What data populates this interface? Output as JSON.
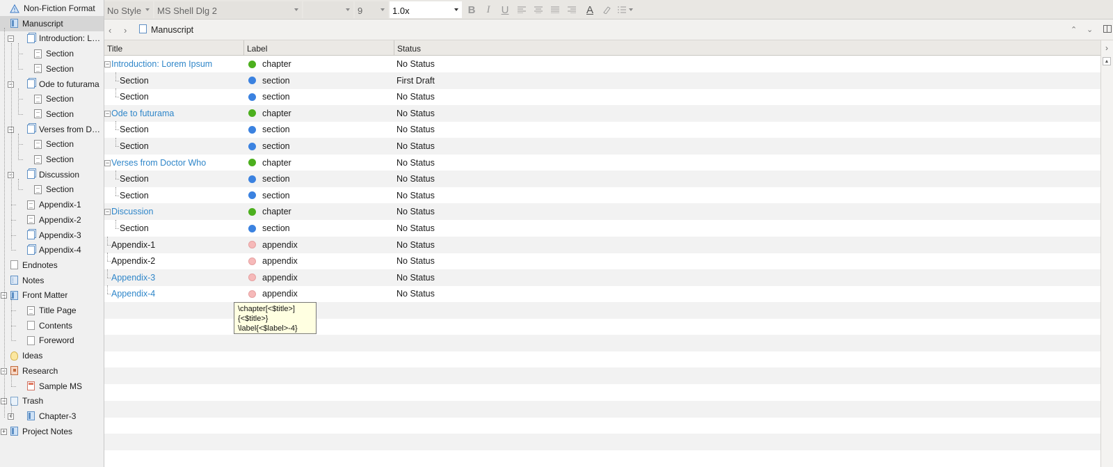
{
  "binder": {
    "items": [
      {
        "label": "Non-Fiction Format",
        "icon": "warning-icon",
        "level": 0
      },
      {
        "label": "Manuscript",
        "icon": "folder-icon",
        "level": 0,
        "selected": true
      },
      {
        "label": "Introduction: Lorem Ipsum",
        "icon": "stack-icon",
        "level": 1,
        "expanded": true
      },
      {
        "label": "Section",
        "icon": "document-icon",
        "level": 2
      },
      {
        "label": "Section",
        "icon": "document-icon",
        "level": 2
      },
      {
        "label": "Ode to futurama",
        "icon": "stack-icon",
        "level": 1,
        "expanded": true
      },
      {
        "label": "Section",
        "icon": "document-icon",
        "level": 2
      },
      {
        "label": "Section",
        "icon": "document-icon",
        "level": 2
      },
      {
        "label": "Verses from Doctor Who",
        "icon": "stack-icon",
        "level": 1,
        "expanded": true
      },
      {
        "label": "Section",
        "icon": "document-icon",
        "level": 2
      },
      {
        "label": "Section",
        "icon": "document-icon",
        "level": 2
      },
      {
        "label": "Discussion",
        "icon": "stack-icon",
        "level": 1,
        "expanded": true
      },
      {
        "label": "Section",
        "icon": "document-icon",
        "level": 2
      },
      {
        "label": "Appendix-1",
        "icon": "document-icon",
        "level": 1
      },
      {
        "label": "Appendix-2",
        "icon": "document-icon",
        "level": 1
      },
      {
        "label": "Appendix-3",
        "icon": "stack-icon",
        "level": 1
      },
      {
        "label": "Appendix-4",
        "icon": "stack-icon",
        "level": 1
      },
      {
        "label": "Endnotes",
        "icon": "blank-document-icon",
        "level": 0
      },
      {
        "label": "Notes",
        "icon": "notes-icon",
        "level": 0
      },
      {
        "label": "Front Matter",
        "icon": "folder-icon",
        "level": 0,
        "expanded": true
      },
      {
        "label": "Title Page",
        "icon": "document-icon",
        "level": 1
      },
      {
        "label": "Contents",
        "icon": "blank-document-icon",
        "level": 1
      },
      {
        "label": "Foreword",
        "icon": "blank-document-icon",
        "level": 1
      },
      {
        "label": "Ideas",
        "icon": "lightbulb-icon",
        "level": 0
      },
      {
        "label": "Research",
        "icon": "research-folder-icon",
        "level": 0,
        "expanded": true
      },
      {
        "label": "Sample MS",
        "icon": "manuscript-icon",
        "level": 1
      },
      {
        "label": "Trash",
        "icon": "trash-icon",
        "level": 0,
        "expanded": true
      },
      {
        "label": "Chapter-3",
        "icon": "folder-icon",
        "level": 1,
        "collapsed": true
      },
      {
        "label": "Project Notes",
        "icon": "folder-icon",
        "level": 0,
        "collapsed": true
      }
    ]
  },
  "format_bar": {
    "style": "No Style",
    "font": "MS Shell Dlg 2",
    "size": "9",
    "line_spacing": "1.0x",
    "buttons": [
      "bold-icon",
      "italic-icon",
      "underline-icon",
      "align-left-icon",
      "align-center-icon",
      "align-justify-icon",
      "align-right-icon",
      "text-color-icon",
      "highlight-icon",
      "list-icon"
    ],
    "glyphs": {
      "bold": "B",
      "italic": "I",
      "underline": "U",
      "text_color": "A"
    }
  },
  "header": {
    "title": "Manuscript"
  },
  "outliner": {
    "columns": [
      "Title",
      "Label",
      "Status"
    ],
    "rows": [
      {
        "title": "Introduction: Lorem Ipsum",
        "label": "chapter",
        "status": "No Status",
        "depth": 0,
        "expanded": true,
        "link": true,
        "label_color": "#4caf1e"
      },
      {
        "title": "Section",
        "label": "section",
        "status": "First Draft",
        "depth": 1,
        "label_color": "#3b82e0"
      },
      {
        "title": "Section",
        "label": "section",
        "status": "No Status",
        "depth": 1,
        "label_color": "#3b82e0"
      },
      {
        "title": "Ode to futurama",
        "label": "chapter",
        "status": "No Status",
        "depth": 0,
        "expanded": true,
        "link": true,
        "label_color": "#4caf1e"
      },
      {
        "title": "Section",
        "label": "section",
        "status": "No Status",
        "depth": 1,
        "label_color": "#3b82e0"
      },
      {
        "title": "Section",
        "label": "section",
        "status": "No Status",
        "depth": 1,
        "label_color": "#3b82e0"
      },
      {
        "title": "Verses from Doctor Who",
        "label": "chapter",
        "status": "No Status",
        "depth": 0,
        "expanded": true,
        "link": true,
        "label_color": "#4caf1e"
      },
      {
        "title": "Section",
        "label": "section",
        "status": "No Status",
        "depth": 1,
        "label_color": "#3b82e0"
      },
      {
        "title": "Section",
        "label": "section",
        "status": "No Status",
        "depth": 1,
        "label_color": "#3b82e0"
      },
      {
        "title": "Discussion",
        "label": "chapter",
        "status": "No Status",
        "depth": 0,
        "expanded": true,
        "link": true,
        "label_color": "#4caf1e"
      },
      {
        "title": "Section",
        "label": "section",
        "status": "No Status",
        "depth": 1,
        "label_color": "#3b82e0"
      },
      {
        "title": "Appendix-1",
        "label": "appendix",
        "status": "No Status",
        "depth": 0,
        "label_color": "#f6b9b9"
      },
      {
        "title": "Appendix-2",
        "label": "appendix",
        "status": "No Status",
        "depth": 0,
        "label_color": "#f6b9b9"
      },
      {
        "title": "Appendix-3",
        "label": "appendix",
        "status": "No Status",
        "depth": 0,
        "link": true,
        "label_color": "#f6b9b9"
      },
      {
        "title": "Appendix-4",
        "label": "appendix",
        "status": "No Status",
        "depth": 0,
        "link": true,
        "label_color": "#f6b9b9"
      }
    ]
  },
  "tooltip": {
    "text": "\\chapter[<$title>]\n{<$title>}\n\\label{<$label>-4}"
  },
  "colors": {
    "link": "#2f86c9",
    "selected_row": "#d6d6d6",
    "tooltip_bg": "#ffffe1",
    "alt_row": "#f2f2f2"
  }
}
